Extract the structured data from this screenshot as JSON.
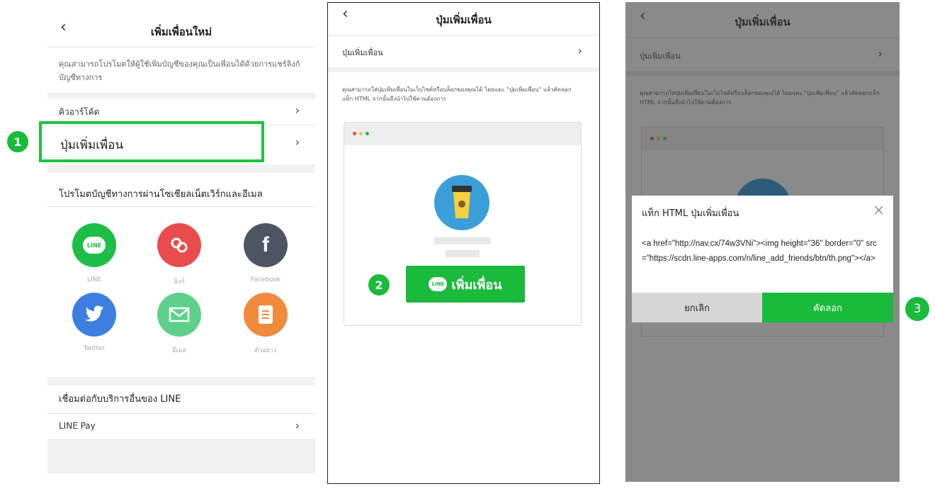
{
  "panel1": {
    "title": "เพิ่มเพื่อนใหม่",
    "description": "คุณสามารถโปรโมตให้ผู้ใช้เพิ่มบัญชีของคุณเป็นเพื่อนได้ด้วยการแชร์ลิงก์บัญชีทางการ",
    "rows": {
      "qr": "คิวอาร์โค้ด",
      "add_button": "ปุ่มเพิ่มเพื่อน"
    },
    "promo_heading": "โปรโมตบัญชีทางการผ่านโซเชียลเน็ตเวิร์กและอีเมล",
    "share": [
      {
        "label": "LINE",
        "icon": "line-icon",
        "color": "#1dbe46"
      },
      {
        "label": "ลิงก์",
        "icon": "link-icon",
        "color": "#e84c4c"
      },
      {
        "label": "Facebook",
        "icon": "facebook-icon",
        "color": "#4d5563"
      },
      {
        "label": "Twitter",
        "icon": "twitter-icon",
        "color": "#3d7fe0"
      },
      {
        "label": "อีเมล",
        "icon": "mail-icon",
        "color": "#5fd08a"
      },
      {
        "label": "ตัวอย่าง",
        "icon": "document-icon",
        "color": "#f08a3c"
      }
    ],
    "line_icon_text": "LINE",
    "connect_heading": "เชื่อมต่อกับบริการอื่นของ LINE",
    "line_pay": "LINE Pay"
  },
  "panel2": {
    "title": "ปุ่มเพิ่มเพื่อน",
    "row": "ปุ่มเพิ่มเพื่อน",
    "description": "คุณสามารถใส่ปุ่มเพิ่มเพื่อนในเว็บไซต์หรือบล็อกของคุณได้ โดยแตะ \"ปุ่มเพิ่มเพื่อน\" แล้วคัดลอกแท็ก HTML จากนั้นจึงนำไปใช้ตามต้องการ",
    "add_friend_label": "เพิ่มเพื่อน",
    "line_logo_text": "LINE"
  },
  "panel3": {
    "title": "ปุ่มเพิ่มเพื่อน",
    "row": "ปุ่มเพิ่มเพื่อน",
    "description": "คุณสามารถใส่ปุ่มเพิ่มเพื่อนในเว็บไซต์หรือบล็อกของคุณได้ โดยแตะ \"ปุ่มเพิ่มเพื่อน\" แล้วคัดลอกแท็ก HTML จากนั้นจึงนำไปใช้ตามต้องการ",
    "dialog": {
      "title": "แท็ก HTML ปุ่มเพิ่มเพื่อน",
      "code": "<a href=\"http://nav.cx/74w3VNi\"><img height=\"36\" border=\"0\" src=\"https://scdn.line-apps.com/n/line_add_friends/btn/th.png\"></a>",
      "cancel": "ยกเลิก",
      "copy": "คัดลอก"
    }
  },
  "steps": {
    "one": "1",
    "two": "2",
    "three": "3"
  },
  "colors": {
    "line_green": "#1aba3b",
    "highlight_border": "#20c33f",
    "overlay": "#8a8a8a"
  }
}
